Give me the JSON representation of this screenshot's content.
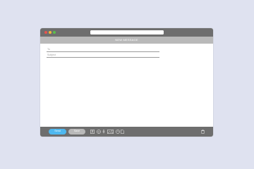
{
  "window": {
    "header_title": "NEW MESSAGE"
  },
  "compose": {
    "to_placeholder": "To",
    "subject_placeholder": "Subject"
  },
  "toolbar": {
    "send_label": "Send",
    "save_label": "Save",
    "icons": [
      "attachment-icon",
      "emoji-icon",
      "microphone-icon",
      "image-icon",
      "clock-icon",
      "document-icon",
      "trash-icon"
    ]
  },
  "colors": {
    "background": "#dfe2f0",
    "chrome": "#6e6e6e",
    "header": "#b9b9b9",
    "send": "#4fb8ef",
    "save": "#b9b9b9"
  }
}
